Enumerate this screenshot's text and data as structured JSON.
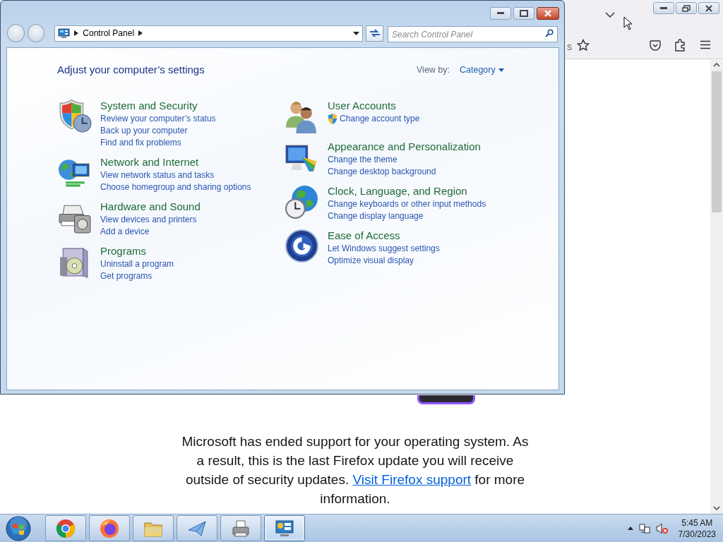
{
  "browser": {
    "address_fragment": "s",
    "notice": {
      "before": "Microsoft has ended support for your operating system. As a result, this is the last Firefox update you will receive outside of security updates. ",
      "link": "Visit Firefox support",
      "after": " for more information."
    }
  },
  "control_panel": {
    "breadcrumb": "Control Panel",
    "search": {
      "placeholder": "Search Control Panel"
    },
    "heading": "Adjust your computer’s settings",
    "view_by": {
      "label": "View by:",
      "value": "Category"
    },
    "columns": [
      [
        {
          "title": "System and Security",
          "links": [
            {
              "text": "Review your computer’s status",
              "shield": false
            },
            {
              "text": "Back up your computer",
              "shield": false
            },
            {
              "text": "Find and fix problems",
              "shield": false
            }
          ]
        },
        {
          "title": "Network and Internet",
          "links": [
            {
              "text": "View network status and tasks",
              "shield": false
            },
            {
              "text": "Choose homegroup and sharing options",
              "shield": false
            }
          ]
        },
        {
          "title": "Hardware and Sound",
          "links": [
            {
              "text": "View devices and printers",
              "shield": false
            },
            {
              "text": "Add a device",
              "shield": false
            }
          ]
        },
        {
          "title": "Programs",
          "links": [
            {
              "text": "Uninstall a program",
              "shield": false
            },
            {
              "text": "Get programs",
              "shield": false
            }
          ]
        }
      ],
      [
        {
          "title": "User Accounts",
          "links": [
            {
              "text": "Change account type",
              "shield": true
            }
          ]
        },
        {
          "title": "Appearance and Personalization",
          "links": [
            {
              "text": "Change the theme",
              "shield": false
            },
            {
              "text": "Change desktop background",
              "shield": false
            }
          ]
        },
        {
          "title": "Clock, Language, and Region",
          "links": [
            {
              "text": "Change keyboards or other input methods",
              "shield": false
            },
            {
              "text": "Change display language",
              "shield": false
            }
          ]
        },
        {
          "title": "Ease of Access",
          "links": [
            {
              "text": "Let Windows suggest settings",
              "shield": false
            },
            {
              "text": "Optimize visual display",
              "shield": false
            }
          ]
        }
      ]
    ]
  },
  "taskbar": {
    "apps": [
      {
        "selected": false
      },
      {
        "selected": false
      },
      {
        "selected": false
      },
      {
        "selected": false
      },
      {
        "selected": false
      },
      {
        "selected": true
      }
    ],
    "time": "5:45 AM",
    "date": "7/30/2023"
  }
}
